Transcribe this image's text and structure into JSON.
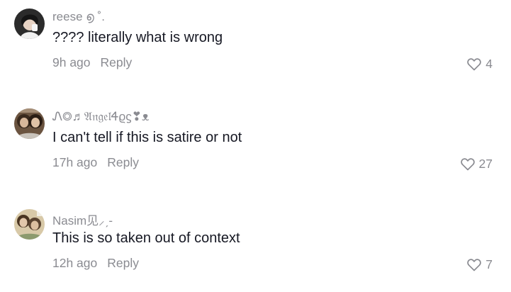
{
  "comments": [
    {
      "username": "reese ൭ ˚.",
      "text": "???? literally what is wrong",
      "time": "9h ago",
      "reply_label": "Reply",
      "likes": "4",
      "avatar_icon": "user-avatar-photo"
    },
    {
      "username": "Ꮑ◎♬𝔄𝔫𝔤𝔢𝔩Ꮞϱϛ❣ᴥ",
      "text": "I can't tell if this is satire or not",
      "time": "17h ago",
      "reply_label": "Reply",
      "likes": "27",
      "avatar_icon": "user-avatar-photo"
    },
    {
      "username": "Nasim⻅⸝ˏ-",
      "text": "This is so taken out of context",
      "time": "12h ago",
      "reply_label": "Reply",
      "likes": "7",
      "avatar_icon": "user-avatar-photo"
    }
  ],
  "icons": {
    "like": "heart-outline-icon"
  },
  "colors": {
    "primary_text": "#161823",
    "secondary_text": "#8a8b91",
    "background": "#ffffff"
  }
}
